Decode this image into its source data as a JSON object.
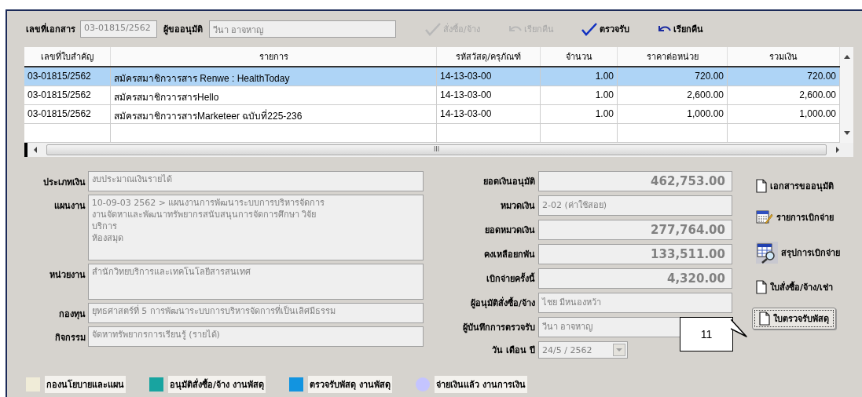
{
  "header": {
    "fields": [
      {
        "label": "เลขที่เอกสาร",
        "value": "03-01815/2562"
      },
      {
        "label": "ผู้ขออนุมัติ",
        "value": "วีนา  อาจหาญ"
      }
    ],
    "toolbar": [
      {
        "kind": "check",
        "label": "สั่งซื้อ/จ้าง",
        "disabled": true
      },
      {
        "kind": "undo",
        "label": "เรียกคืน",
        "disabled": true
      },
      {
        "kind": "check",
        "label": "ตรวจรับ",
        "disabled": false
      },
      {
        "kind": "undo",
        "label": "เรียกคืน",
        "disabled": false
      }
    ]
  },
  "table": {
    "columns": [
      "เลขที่ใบสำคัญ",
      "รายการ",
      "รหัสวัสดุ/ครุภัณฑ์",
      "จำนวน",
      "ราคาต่อหน่วย",
      "รวมเงิน"
    ],
    "rows": [
      {
        "selected": true,
        "cells": [
          "03-01815/2562",
          "สมัครสมาชิกวารสาร Renwe : HealthToday",
          "14-13-03-00",
          "1.00",
          "720.00",
          "720.00"
        ]
      },
      {
        "selected": false,
        "cells": [
          "03-01815/2562",
          "สมัครสมาชิกวารสารHello",
          "14-13-03-00",
          "1.00",
          "2,600.00",
          "2,600.00"
        ]
      },
      {
        "selected": false,
        "cells": [
          "03-01815/2562",
          "สมัครสมาชิกวารสารMarketeer ฉบับที่225-236",
          "14-13-03-00",
          "1.00",
          "1,000.00",
          "1,000.00"
        ]
      }
    ],
    "scroll_thumb": "III"
  },
  "left_fields": [
    {
      "label": "ประเภทเงิน",
      "lines": [
        "งบประมาณเงินรายได้"
      ],
      "kind": "single"
    },
    {
      "label": "แผนงาน",
      "lines": [
        "10-09-03 2562 > แผนงานการพัฒนาระบบการบริหารจัดการ",
        "งานจัดหาและพัฒนาทรัพยากรสนับสนุนการจัดการศึกษา วิจัย",
        "บริการ",
        "ห้องสมุด"
      ],
      "kind": "tall"
    },
    {
      "label": "หน่วยงาน",
      "lines": [
        "สำนักวิทยบริการและเทคโนโลยีสารสนเทศ"
      ],
      "kind": "medium"
    },
    {
      "label": "กองทุน",
      "lines": [
        "ยุทธศาสตร์ที่ 5  การพัฒนาระบบการบริหารจัดการที่เป็นเลิศมีธรรม"
      ],
      "kind": "single"
    },
    {
      "label": "กิจกรรม",
      "lines": [
        "จัดหาทรัพยากรการเรียนรู้ (รายได้)"
      ],
      "kind": "single"
    }
  ],
  "mid_fields": [
    {
      "label": "ยอดเงินอนุมัติ",
      "value": "462,753.00",
      "kind": "amount"
    },
    {
      "label": "หมวดเงิน",
      "value": "2-02  (ค่าใช้สอย)",
      "kind": "text"
    },
    {
      "label": "ยอดหมวดเงิน",
      "value": "277,764.00",
      "kind": "amount"
    },
    {
      "label": "คงเหลือยกพัน",
      "value": "133,511.00",
      "kind": "amount"
    },
    {
      "label": "เบิกจ่ายครั้งนี้",
      "value": "4,320.00",
      "kind": "amount"
    },
    {
      "label": "ผู้อนุมัติสั่งซื้อ/จ้าง",
      "value": "ไชย  มีหนองหว้า",
      "kind": "text"
    },
    {
      "label": "ผู้บันทึกการตรวจรับ",
      "value": "วีนา  อาจหาญ",
      "kind": "short"
    },
    {
      "label": "วัน เดือน ปี",
      "value": "24/5 / 2562",
      "kind": "date"
    }
  ],
  "side_buttons": [
    {
      "kind": "document",
      "label": "เอกสารขออนุมัติ",
      "focused": false
    },
    {
      "kind": "edit-list",
      "label": "รายการเบิกจ่าย",
      "focused": false
    },
    {
      "kind": "table-search",
      "label": "สรุปการเบิกจ่าย",
      "focused": false
    },
    {
      "kind": "document",
      "label": "ใบสั่งซื้อ/จ้าง/เช่า",
      "focused": false
    },
    {
      "kind": "document",
      "label": "ใบตรวจรับพัสดุ",
      "focused": true
    }
  ],
  "callout": {
    "text": "11"
  },
  "legend": [
    {
      "label": "กองนโยบายและแผน",
      "color": "#f0ecd8",
      "kind": "square"
    },
    {
      "label": "อนุมัติสั่งซื้อ/จ้าง งานพัสดุ",
      "color": "#18a4a0",
      "kind": "square"
    },
    {
      "label": "ตรวจรับพัสดุ งานพัสดุ",
      "color": "#1294e0",
      "kind": "square"
    },
    {
      "label": "จ่ายเงินแล้ว งานการเงิน",
      "color": "#c4c4ff",
      "kind": "round"
    }
  ]
}
